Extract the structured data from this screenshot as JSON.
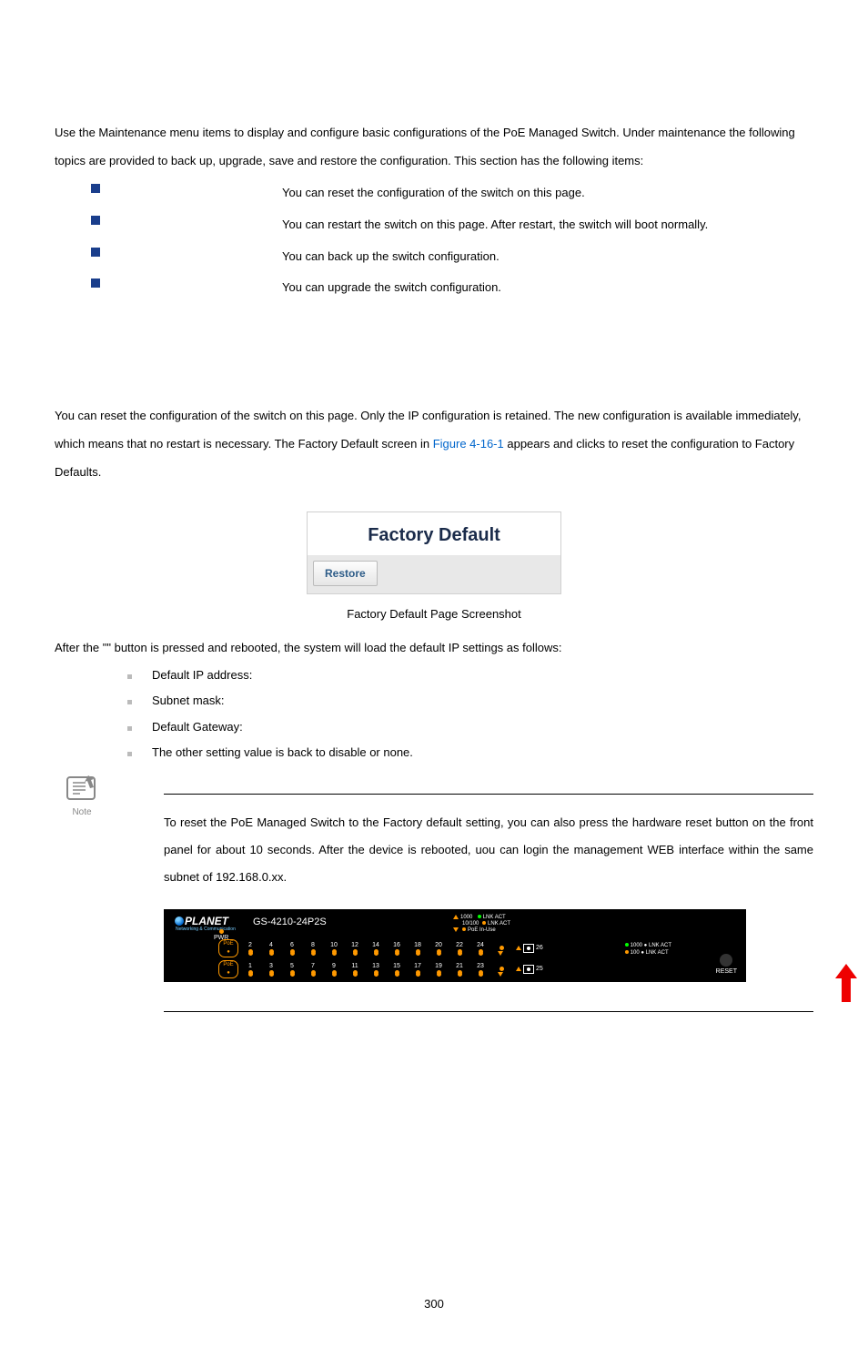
{
  "intro": "Use the Maintenance menu items to display and configure basic configurations of the PoE Managed Switch. Under maintenance the following topics are provided to back up, upgrade, save and restore the configuration. This section has the following items:",
  "bullets": [
    "You can reset the configuration of the switch on this page.",
    "You can restart the switch on this page. After restart, the switch will boot normally.",
    "You can back up the switch configuration.",
    "You can upgrade the switch configuration."
  ],
  "section2_para_a": "You can reset the configuration of the switch on this page. Only the IP configuration is retained. The new configuration is available immediately, which means that no restart is necessary. The Factory Default screen in ",
  "fig_ref": "Figure 4-16-1",
  "section2_para_b": " appears and clicks to reset the configuration to Factory Defaults.",
  "fd_title": "Factory Default",
  "fd_button": "Restore",
  "caption": "Factory Default Page Screenshot",
  "after_a": "After the \"",
  "after_b": "\" button is pressed and rebooted, the system will load the default IP settings as follows:",
  "defaults": [
    "Default IP address:",
    "Subnet mask:",
    "Default Gateway:",
    "The other setting value is back to disable or none."
  ],
  "note_text": "To reset the PoE Managed Switch to the Factory default setting, you can also press the hardware reset button on the front panel for about 10 seconds. After the device is rebooted, uou can login the management WEB interface within the same subnet of 192.168.0.xx.",
  "note_label": "Note",
  "switch": {
    "brand": "PLANET",
    "subbrand": "Networking & Communication",
    "model": "GS-4210-24P2S",
    "pwr": "PWR",
    "poe_pill": "PoE ●",
    "top_ports": [
      "2",
      "4",
      "6",
      "8",
      "10",
      "12",
      "14",
      "16",
      "18",
      "20",
      "22",
      "24"
    ],
    "bottom_ports": [
      "1",
      "3",
      "5",
      "7",
      "9",
      "11",
      "13",
      "15",
      "17",
      "19",
      "21",
      "23"
    ],
    "sfp_top": "26",
    "sfp_bottom": "25",
    "legend_top_1": "1000",
    "legend_top_2": "10/100",
    "legend_top_3": "PoE In-Use",
    "legend_lnkact": "LNK   ACT",
    "legend_right_1": "1000 ● LNK    ACT",
    "legend_right_2": "100  ● LNK    ACT",
    "reset": "RESET"
  },
  "page_number": "300"
}
